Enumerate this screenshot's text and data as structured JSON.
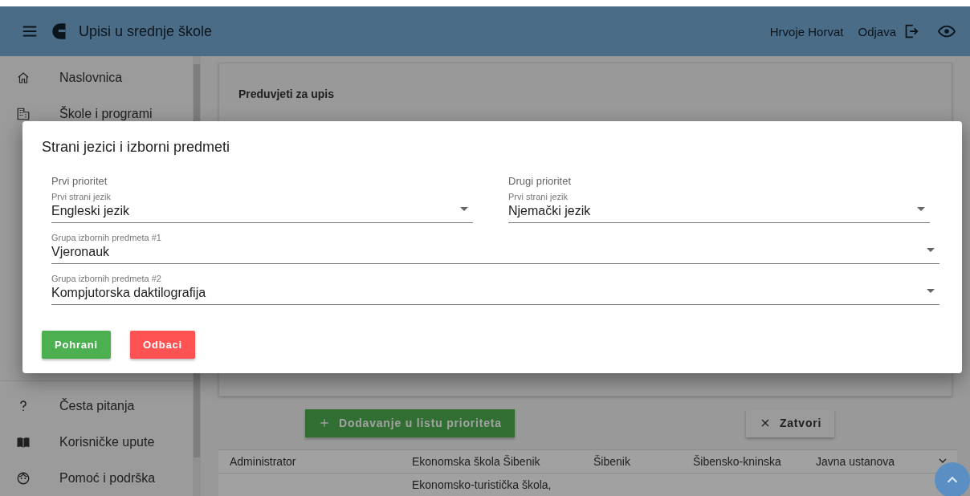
{
  "header": {
    "title": "Upisi u srednje škole",
    "user": "Hrvoje Horvat",
    "logout": "Odjava"
  },
  "sidebar": {
    "top_items": [
      {
        "label": "Naslovnica"
      },
      {
        "label": "Škole i programi"
      }
    ],
    "bottom_items": [
      {
        "label": "Česta pitanja"
      },
      {
        "label": "Korisničke upute"
      },
      {
        "label": "Pomoć i podrška"
      }
    ]
  },
  "content": {
    "card_title": "Preduvjeti za upis",
    "actions": [
      {
        "label": "Dodavanje u listu prioriteta",
        "kind": "add"
      },
      {
        "label": "Zatvori",
        "kind": "close"
      }
    ],
    "table": {
      "rows": [
        [
          "Administrator",
          "Ekonomska škola Šibenik",
          "Šibenik",
          "Šibensko-kninska",
          "Javna ustanova"
        ],
        [
          "",
          "Ekonomsko-turistička škola,",
          "",
          "",
          ""
        ]
      ]
    }
  },
  "dialog": {
    "title": "Strani jezici i izborni predmeti",
    "columns": [
      {
        "heading": "Prvi prioritet",
        "field": {
          "label": "Prvi strani jezik",
          "value": "Engleski jezik"
        }
      },
      {
        "heading": "Drugi prioritet",
        "field": {
          "label": "Prvi strani jezik",
          "value": "Njemački jezik"
        }
      }
    ],
    "fields": [
      {
        "label": "Grupa izbornih predmeta #1",
        "value": "Vjeronauk"
      },
      {
        "label": "Grupa izbornih predmeta #2",
        "value": "Kompjutorska daktilografija"
      }
    ],
    "buttons": [
      {
        "label": "Pohrani",
        "kind": "primary"
      },
      {
        "label": "Odbaci",
        "kind": "danger"
      }
    ]
  }
}
